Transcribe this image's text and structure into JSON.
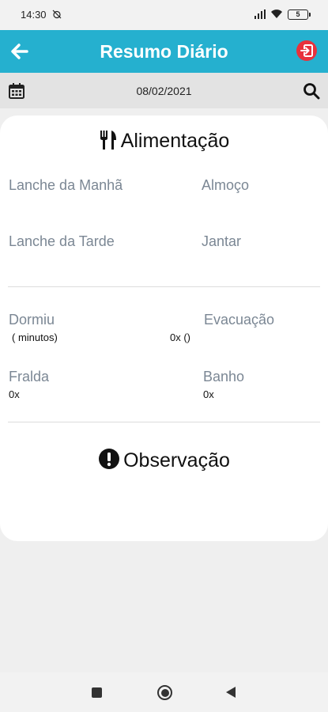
{
  "status_bar": {
    "time": "14:30",
    "battery": "5"
  },
  "app_bar": {
    "title": "Resumo Diário",
    "accent_color": "#25b0cf",
    "logout_color": "#e8323c"
  },
  "date_bar": {
    "date": "08/02/2021"
  },
  "alimentacao": {
    "title": "Alimentação",
    "fields": {
      "lanche_manha": "Lanche da Manhã",
      "almoco": "Almoço",
      "lanche_tarde": "Lanche da Tarde",
      "jantar": "Jantar"
    }
  },
  "rotina": {
    "dormiu": {
      "label": "Dormiu",
      "value": "( minutos)"
    },
    "evacuacao": {
      "label": "Evacuação",
      "value": "0x ()"
    },
    "fralda": {
      "label": "Fralda",
      "value": "0x"
    },
    "banho": {
      "label": "Banho",
      "value": "0x"
    }
  },
  "observacao": {
    "title": "Observação"
  },
  "icons": {
    "back": "arrow-left-icon",
    "logout": "logout-icon",
    "calendar": "calendar-icon",
    "search": "search-icon",
    "food": "utensils-icon",
    "observation": "exclamation-circle-icon"
  }
}
